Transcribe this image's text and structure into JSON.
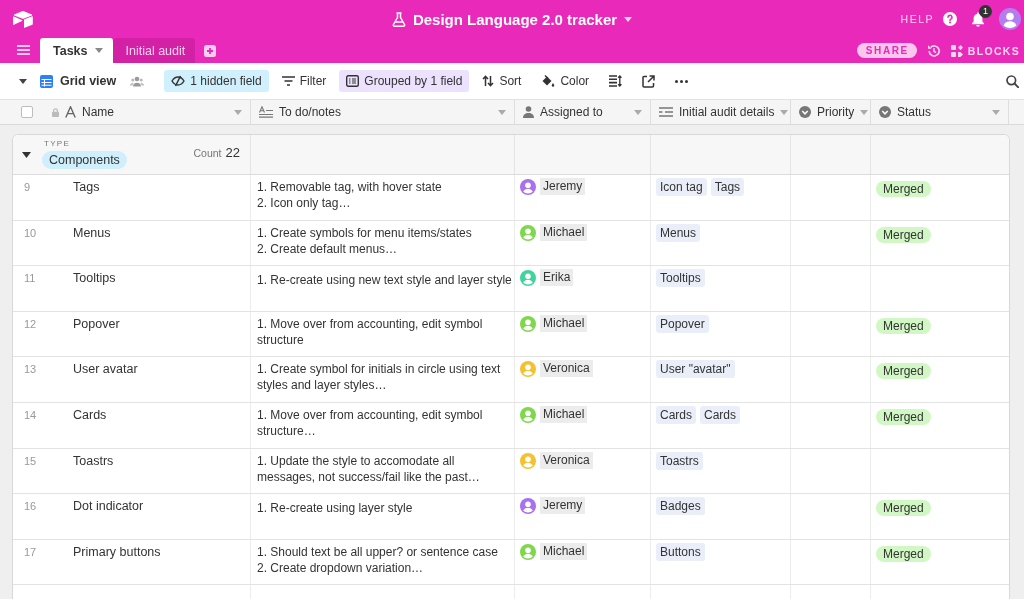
{
  "header": {
    "title": "Design Language 2.0 tracker",
    "help": "HELP",
    "notification_count": "1",
    "share": "SHARE",
    "blocks": "BLOCKS"
  },
  "tabs": [
    {
      "label": "Tasks",
      "selected": true
    },
    {
      "label": "Initial audit",
      "selected": false
    }
  ],
  "toolbar": {
    "view": "Grid view",
    "buttons": [
      {
        "kind": "hide",
        "label": "1 hidden field",
        "active": true
      },
      {
        "kind": "filter",
        "label": "Filter",
        "active": false
      },
      {
        "kind": "group",
        "label": "Grouped by 1 field",
        "active": true
      },
      {
        "kind": "sort",
        "label": "Sort",
        "active": false
      },
      {
        "kind": "color",
        "label": "Color",
        "active": false
      },
      {
        "kind": "row_height",
        "active": false
      },
      {
        "kind": "share",
        "active": false
      },
      {
        "kind": "more",
        "active": false
      }
    ]
  },
  "table": {
    "select_all": {
      "checked": false
    },
    "columns": [
      {
        "label": "Name",
        "kind": "primary"
      },
      {
        "label": "To do/notes",
        "kind": "long_text"
      },
      {
        "label": "Assigned to",
        "kind": "collaborator"
      },
      {
        "label": "Initial audit details",
        "kind": "link"
      },
      {
        "label": "Priority",
        "kind": "select"
      },
      {
        "label": "Status",
        "kind": "select"
      }
    ],
    "group": {
      "field": "TYPE",
      "value": "Components",
      "count_label": "Count",
      "count": "22",
      "expanded": true
    },
    "rows": [
      {
        "number": "9",
        "name": "Tags",
        "notes": "1. Removable tag, with hover state\n2. Icon only tag…",
        "assignee": {
          "name": "Jeremy",
          "color": "#a970f0"
        },
        "audit_details": [
          "Icon tag",
          "Tags"
        ],
        "status": "Merged"
      },
      {
        "number": "10",
        "name": "Menus",
        "notes": "1. Create symbols for menu items/states\n2. Create default menus…",
        "assignee": {
          "name": "Michael",
          "color": "#7fd74b"
        },
        "audit_details": [
          "Menus"
        ],
        "status": "Merged"
      },
      {
        "number": "11",
        "name": "Tooltips",
        "notes": "1. Re-create using new text style and layer style",
        "assignee": {
          "name": "Erika",
          "color": "#3fd49b"
        },
        "audit_details": [
          "Tooltips"
        ]
      },
      {
        "number": "12",
        "name": "Popover",
        "notes": "1. Move over from accounting, edit symbol\nstructure",
        "assignee": {
          "name": "Michael",
          "color": "#7fd74b"
        },
        "audit_details": [
          "Popover"
        ],
        "status": "Merged"
      },
      {
        "number": "13",
        "name": "User avatar",
        "notes": "1. Create symbol for initials in circle using text\nstyles and layer styles…",
        "assignee": {
          "name": "Veronica",
          "color": "#f5c131"
        },
        "audit_details": [
          "User \"avatar\""
        ],
        "status": "Merged"
      },
      {
        "number": "14",
        "name": "Cards",
        "notes": "1. Move over from accounting, edit symbol\nstructure…",
        "assignee": {
          "name": "Michael",
          "color": "#7fd74b"
        },
        "audit_details": [
          "Cards",
          "Cards"
        ],
        "status": "Merged"
      },
      {
        "number": "15",
        "name": "Toastrs",
        "notes": "1. Update the style to accomodate all\nmessages, not success/fail like the past…",
        "assignee": {
          "name": "Veronica",
          "color": "#f5c131"
        },
        "audit_details": [
          "Toastrs"
        ]
      },
      {
        "number": "16",
        "name": "Dot indicator",
        "notes": "1. Re-create using layer style",
        "assignee": {
          "name": "Jeremy",
          "color": "#a970f0"
        },
        "audit_details": [
          "Badges"
        ],
        "status": "Merged"
      },
      {
        "number": "17",
        "name": "Primary buttons",
        "notes": "1. Should text be all upper? or sentence case\n2. Create dropdown variation…",
        "assignee": {
          "name": "Michael",
          "color": "#7fd74b"
        },
        "audit_details": [
          "Buttons"
        ],
        "status": "Merged"
      }
    ]
  }
}
